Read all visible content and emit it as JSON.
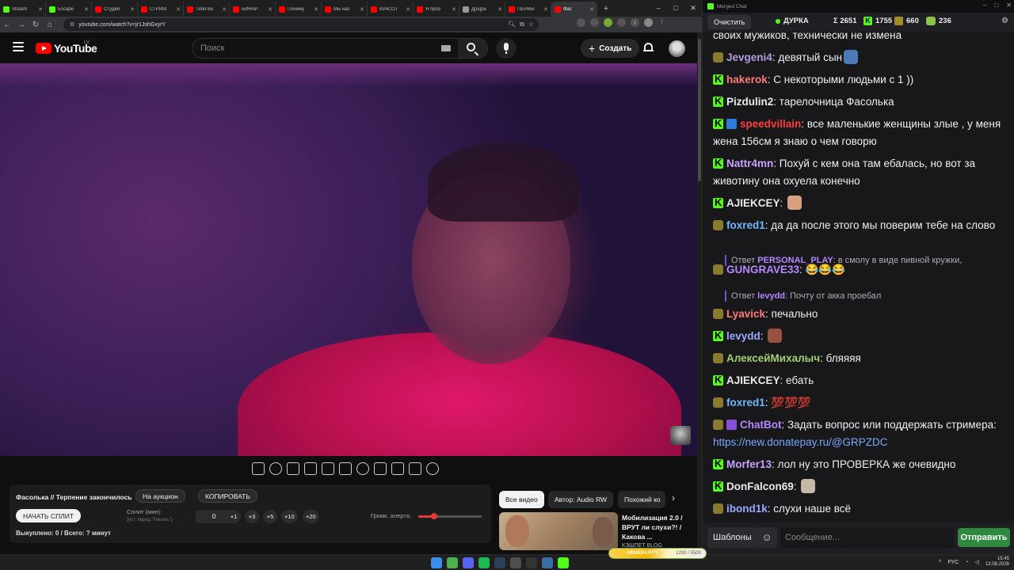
{
  "browser": {
    "tabs": [
      {
        "title": "Stream",
        "color": "#53fc18"
      },
      {
        "title": "Escape",
        "color": "#53fc18"
      },
      {
        "title": "Студия",
        "color": "#ff0000"
      },
      {
        "title": "СТРИМ",
        "color": "#ff0000"
      },
      {
        "title": "Тебя Bu",
        "color": "#ff0000"
      },
      {
        "title": "БИНАР",
        "color": "#ff0000"
      },
      {
        "title": "Почему",
        "color": "#ff0000"
      },
      {
        "title": "Мы нас",
        "color": "#ff0000"
      },
      {
        "title": "КРАСОТ",
        "color": "#ff0000"
      },
      {
        "title": "Я проэ",
        "color": "#ff0000"
      },
      {
        "title": "Д[ш]ра",
        "color": "#999999"
      },
      {
        "title": "ПЕРВЫ",
        "color": "#ff0000"
      },
      {
        "title": "Фас",
        "color": "#ff0000"
      }
    ],
    "url": "youtube.com/watch?v=jr1JshGxyrY"
  },
  "youtube": {
    "logo_text": "YouTube",
    "region": "LV",
    "search_placeholder": "Поиск",
    "create_label": "Создать"
  },
  "split": {
    "title": "Фасолька // Терпение закончилось",
    "auction_label": "На аукцион",
    "copy_label": "КОПИРОВАТЬ",
    "start_label": "НАЧАТЬ СПЛИТ",
    "split_label": "Сплит (мин):",
    "split_hint": "(уст. перед \"Начать\")",
    "split_value": "0",
    "increments": [
      "+1",
      "+3",
      "+5",
      "+10",
      "+20"
    ],
    "bought_text": "Выкуплено: 0 / Всего: ? минут",
    "volume_label": "Громк. алерта:",
    "volume_level": 0.25
  },
  "recommendations": {
    "chips": [
      {
        "label": "Все видео",
        "active": true
      },
      {
        "label": "Автор: Audio RW",
        "active": false
      },
      {
        "label": "Похожий ко",
        "active": false
      }
    ],
    "card": {
      "title": "Мобилизация 2.0 / ВРУТ ли слухи?! / Какова ...",
      "meta": "КЭШПЕТ BLOG"
    }
  },
  "chat": {
    "window_title": "Merged Chat",
    "clear_label": "Очистить",
    "streamer": "ДУРКА",
    "total": "Σ 2651",
    "kick_count": "1755",
    "tw_count": "660",
    "yt_count": "236",
    "messages": [
      {
        "badges": [],
        "nick": "",
        "nick_color": "#efeff1",
        "text": "своих мужиков, технически не измена",
        "emote": ""
      },
      {
        "badges": [
          "t"
        ],
        "nick": "Jevgeni4",
        "nick_color": "#b39ddb",
        "text": "девятый сын",
        "emote": "#4a7ab8"
      },
      {
        "badges": [
          "k"
        ],
        "nick": "hakerok",
        "nick_color": "#ff7b7b",
        "text": "С некоторыми людьми с 1 ))",
        "emote": ""
      },
      {
        "badges": [
          "k"
        ],
        "nick": "Pizdulin2",
        "nick_color": "#eaeaea",
        "text": "тарелочница Фасолька",
        "emote": ""
      },
      {
        "badges": [
          "k",
          "b"
        ],
        "nick": "speedvillain",
        "nick_color": "#ff3b3b",
        "text": "все маленькие женщины злые , у меня жена 156см я знаю о чем говорю",
        "emote": ""
      },
      {
        "badges": [
          "k"
        ],
        "nick": "Nattr4mn",
        "nick_color": "#c8a2ff",
        "text": "Похуй с кем она там ебалась, но вот за животину она охуела конечно",
        "emote": ""
      },
      {
        "badges": [
          "k"
        ],
        "nick": "AJIEKCEY",
        "nick_color": "#eaeaea",
        "text": "",
        "emote": "#d8a080"
      },
      {
        "badges": [
          "t"
        ],
        "nick": "foxred1",
        "nick_color": "#6fb6ff",
        "text": "да да после этого мы поверим тебе на слово",
        "emote": ""
      },
      {
        "badges": [
          "t"
        ],
        "nick": "GUNGRAVE33",
        "nick_color": "#b388ff",
        "text": "😂😂😂",
        "emote": ""
      },
      {
        "badges": [
          "t"
        ],
        "nick": "Lyavick",
        "nick_color": "#ff7b7b",
        "text": "печально",
        "emote": ""
      },
      {
        "badges": [
          "k"
        ],
        "nick": "levydd",
        "nick_color": "#9aa8ff",
        "text": "",
        "emote": "#9a5040"
      },
      {
        "badges": [
          "t"
        ],
        "nick": "АлексейМихалыч",
        "nick_color": "#a5d06f",
        "text": "бляяяя",
        "emote": ""
      },
      {
        "badges": [
          "k"
        ],
        "nick": "AJIEKCEY",
        "nick_color": "#eaeaea",
        "text": "ебать",
        "emote": ""
      },
      {
        "badges": [
          "t"
        ],
        "nick": "foxred1",
        "nick_color": "#6fb6ff",
        "text": "💯💯💯",
        "emote": ""
      },
      {
        "badges": [
          "t",
          "m"
        ],
        "nick": "ChatBot",
        "nick_color": "#b388ff",
        "text": "Задать вопрос или поддержать стримера: ",
        "link": "https://new.donatepay.ru/@GRPZDC",
        "emote": ""
      },
      {
        "badges": [
          "k"
        ],
        "nick": "Morfer13",
        "nick_color": "#c8a2ff",
        "text": "лол ну это ПРОВЕРКА же очевидно",
        "emote": ""
      },
      {
        "badges": [
          "k"
        ],
        "nick": "DonFalcon69",
        "nick_color": "#eaeaea",
        "text": "",
        "emote": "#c8b8a8"
      },
      {
        "badges": [
          "t"
        ],
        "nick": "ibond1k",
        "nick_color": "#9aa8ff",
        "text": "слухи наше всё",
        "emote": ""
      }
    ],
    "replies": [
      {
        "prefix": "Ответ",
        "nick": "PERSONAL_PLAY",
        "text": ": в смолу в виде пивной кружки,"
      },
      {
        "prefix": "Ответ",
        "nick": "levydd",
        "text": ": Почту от акка проебал"
      }
    ],
    "templates_label": "Шаблоны",
    "input_placeholder": "Сообщение...",
    "send_label": "Отправить"
  },
  "taskbar": {
    "alert_name": "HEHEPARTY",
    "alert_value": "1200 / 5500",
    "lang": "РУС",
    "time": "15:45",
    "date": "13.08.2026"
  }
}
